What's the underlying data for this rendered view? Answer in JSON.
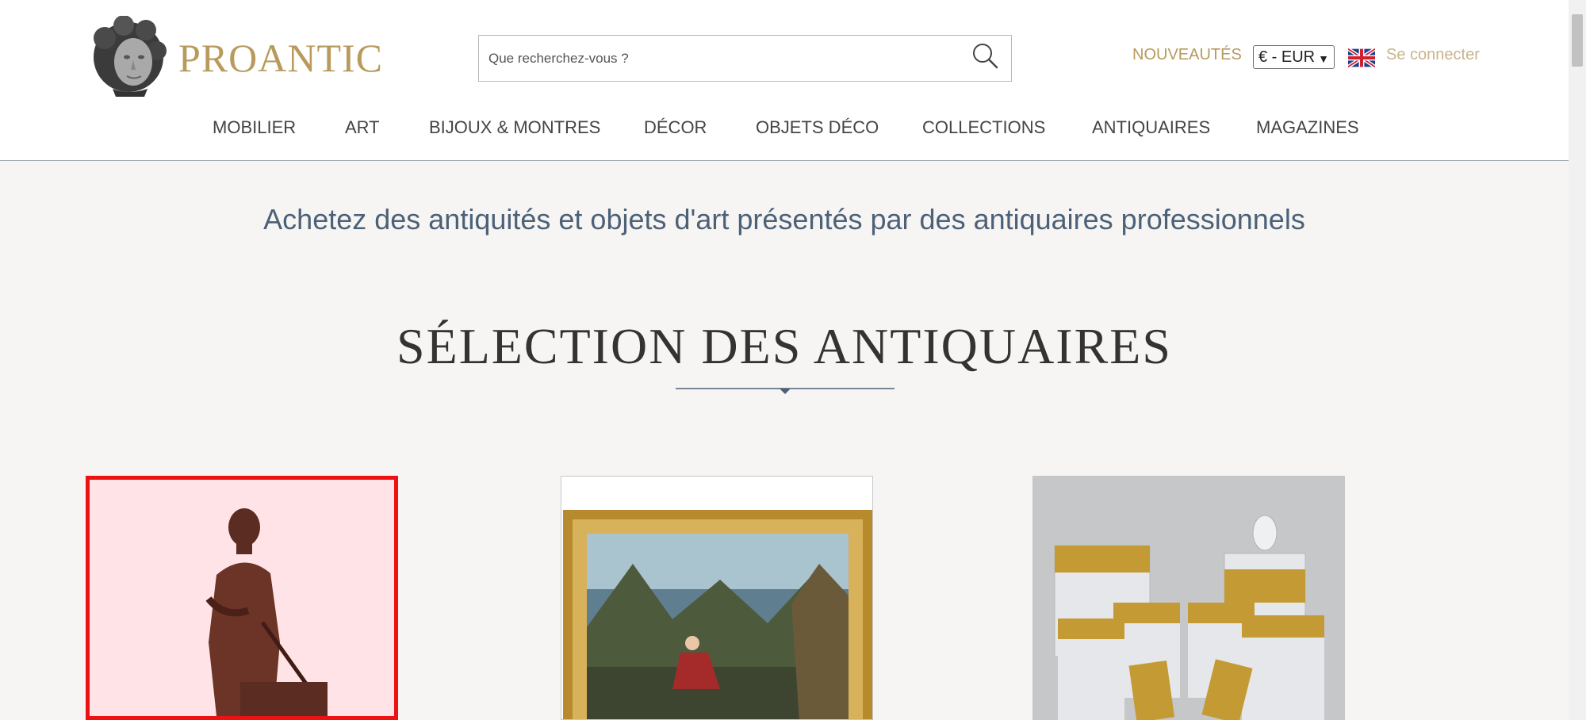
{
  "header": {
    "logo_text": "PROANTIC",
    "search": {
      "placeholder": "Que recherchez-vous ?",
      "value": ""
    },
    "nouveautes_label": "NOUVEAUTÉS",
    "currency_selected": "€ - EUR",
    "language_flag": "uk-flag-icon",
    "login_label": "Se connecter"
  },
  "nav": {
    "items": [
      "MOBILIER",
      "ART",
      "BIJOUX & MONTRES",
      "DÉCOR",
      "OBJETS DÉCO",
      "COLLECTIONS",
      "ANTIQUAIRES",
      "MAGAZINES"
    ]
  },
  "main": {
    "tagline": "Achetez des antiquités et objets d'art présentés par des antiquaires professionnels",
    "section_title": "SÉLECTION DES ANTIQUAIRES"
  },
  "cards": [
    {
      "subject": "bronze kneeling knight statue",
      "highlight_color": "#ee1111"
    },
    {
      "subject": "landscape painting in gilded frame"
    },
    {
      "subject": "crystal glasses and decanter with gold rims"
    }
  ],
  "colors": {
    "brand_gold": "#b89a5c",
    "tagline_blue": "#4c6178",
    "page_bg": "#f6f5f3"
  }
}
